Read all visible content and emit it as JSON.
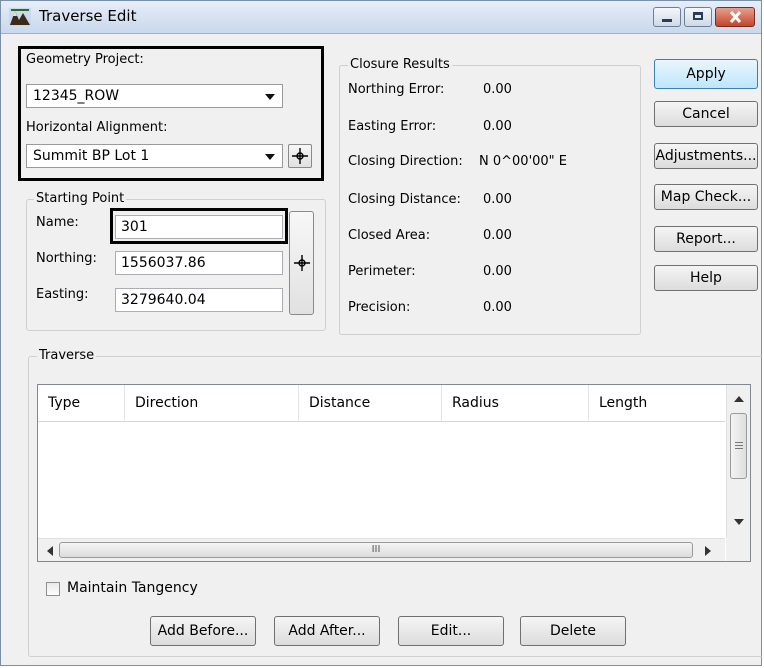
{
  "window": {
    "title": "Traverse Edit"
  },
  "geometry_project": {
    "label": "Geometry Project:",
    "value": "12345_ROW"
  },
  "horizontal_alignment": {
    "label": "Horizontal Alignment:",
    "value": "Summit BP Lot 1"
  },
  "starting_point": {
    "legend": "Starting Point",
    "name_label": "Name:",
    "name_value": "301",
    "northing_label": "Northing:",
    "northing_value": "1556037.86",
    "easting_label": "Easting:",
    "easting_value": "3279640.04"
  },
  "closure": {
    "legend": "Closure Results",
    "northing_error_label": "Northing Error:",
    "northing_error": "0.00",
    "easting_error_label": "Easting Error:",
    "easting_error": "0.00",
    "closing_direction_label": "Closing Direction:",
    "closing_direction": "N  0^00'00\" E",
    "closing_distance_label": "Closing Distance:",
    "closing_distance": "0.00",
    "closed_area_label": "Closed Area:",
    "closed_area": "0.00",
    "perimeter_label": "Perimeter:",
    "perimeter": "0.00",
    "precision_label": "Precision:",
    "precision": "0.00"
  },
  "buttons": {
    "apply": "Apply",
    "cancel": "Cancel",
    "adjustments": "Adjustments...",
    "map_check": "Map Check...",
    "report": "Report...",
    "help": "Help"
  },
  "traverse": {
    "legend": "Traverse",
    "columns": [
      "Type",
      "Direction",
      "Distance",
      "Radius",
      "Length"
    ],
    "scroll_mid": "III"
  },
  "maintain_tangency": {
    "label": "Maintain Tangency",
    "checked": false
  },
  "actions": {
    "add_before": "Add Before...",
    "add_after": "Add After...",
    "edit": "Edit...",
    "delete": "Delete"
  }
}
